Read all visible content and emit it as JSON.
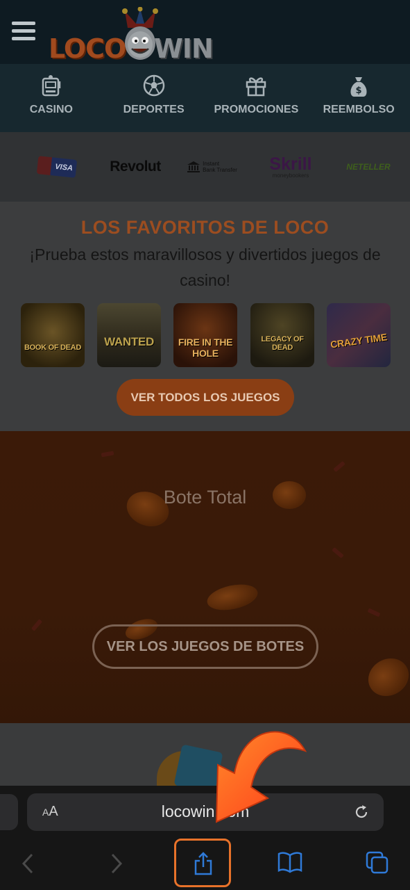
{
  "header": {
    "menu_icon": "hamburger-icon",
    "logo_left": "LOCO",
    "logo_right": "WIN"
  },
  "nav": {
    "items": [
      {
        "label": "CASINO",
        "icon": "slot-machine-icon"
      },
      {
        "label": "DEPORTES",
        "icon": "soccer-ball-icon"
      },
      {
        "label": "PROMOCIONES",
        "icon": "gift-icon"
      },
      {
        "label": "REEMBOLSO",
        "icon": "money-bag-icon"
      }
    ]
  },
  "payments": {
    "visa": "VISA",
    "revolut": "Revolut",
    "bank_line1": "Instant",
    "bank_line2": "Bank Transfer",
    "skrill": "Skrill",
    "skrill_sub": "moneybookers",
    "neteller": "NETELLER"
  },
  "favorites": {
    "title": "LOS FAVORITOS DE LOCO",
    "subtitle": "¡Prueba estos maravillosos y divertidos juegos de casino!",
    "games": [
      {
        "name": "BOOK OF DEAD"
      },
      {
        "name": "WANTED"
      },
      {
        "name": "FIRE IN THE HOLE"
      },
      {
        "name": "LEGACY OF DEAD"
      },
      {
        "name": "CRAZY TIME"
      }
    ],
    "button": "VER TODOS LOS JUEGOS"
  },
  "jackpot": {
    "title": "Bote Total",
    "button": "VER LOS JUEGOS DE BOTES"
  },
  "browser": {
    "aa_label": "AA",
    "url": "locowin.com",
    "toolbar_icons": [
      "back-icon",
      "forward-icon",
      "share-icon",
      "bookmarks-icon",
      "tabs-icon"
    ]
  },
  "colors": {
    "accent": "#e8722a",
    "brand_orange": "#9c4d20",
    "header_bg": "#0e1b22"
  }
}
